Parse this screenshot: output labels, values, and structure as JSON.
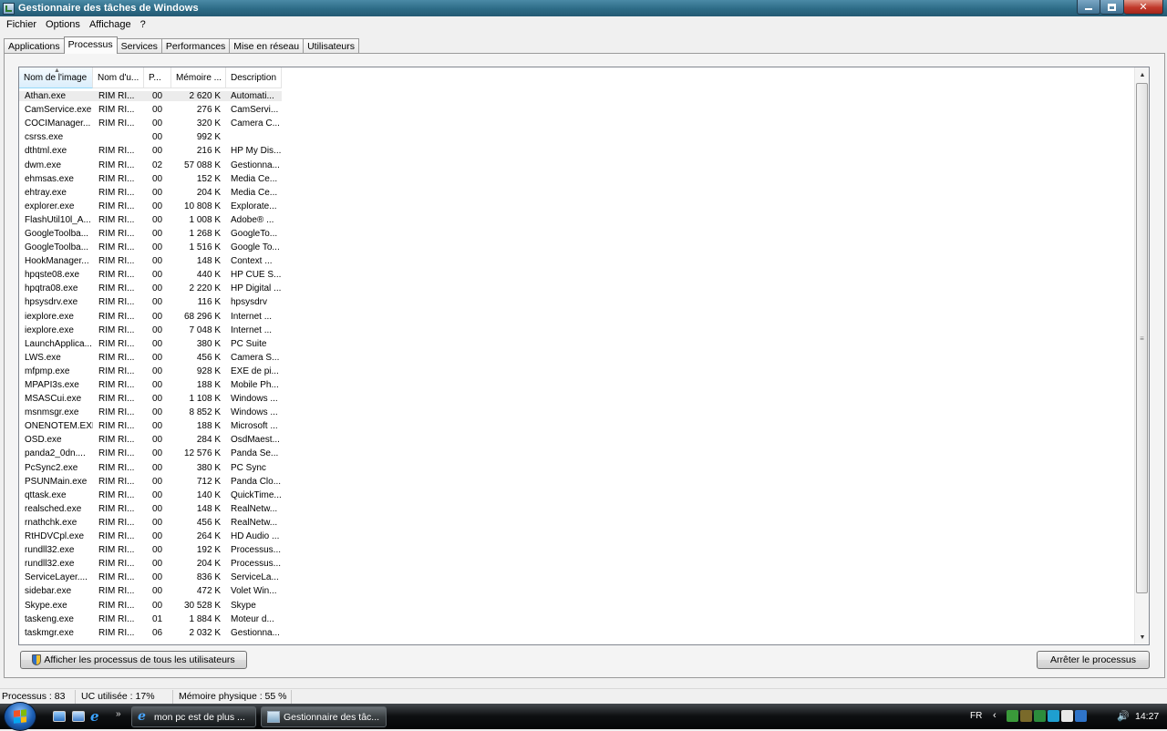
{
  "window": {
    "title": "Gestionnaire des tâches de Windows"
  },
  "menu": [
    "Fichier",
    "Options",
    "Affichage",
    "?"
  ],
  "tabs": [
    "Applications",
    "Processus",
    "Services",
    "Performances",
    "Mise en réseau",
    "Utilisateurs"
  ],
  "active_tab": "Processus",
  "columns": [
    "Nom de l'image",
    "Nom d'u...",
    "P...",
    "Mémoire ...",
    "Description"
  ],
  "rows": [
    {
      "name": "Athan.exe",
      "user": "RIM RI...",
      "cpu": "00",
      "mem": "2 620 K",
      "desc": "Automati..."
    },
    {
      "name": "CamService.exe",
      "user": "RIM RI...",
      "cpu": "00",
      "mem": "276 K",
      "desc": "CamServi..."
    },
    {
      "name": "COCIManager...",
      "user": "RIM RI...",
      "cpu": "00",
      "mem": "320 K",
      "desc": "Camera C..."
    },
    {
      "name": "csrss.exe",
      "user": "",
      "cpu": "00",
      "mem": "992 K",
      "desc": ""
    },
    {
      "name": "dthtml.exe",
      "user": "RIM RI...",
      "cpu": "00",
      "mem": "216 K",
      "desc": "HP My Dis..."
    },
    {
      "name": "dwm.exe",
      "user": "RIM RI...",
      "cpu": "02",
      "mem": "57 088 K",
      "desc": "Gestionna..."
    },
    {
      "name": "ehmsas.exe",
      "user": "RIM RI...",
      "cpu": "00",
      "mem": "152 K",
      "desc": "Media Ce..."
    },
    {
      "name": "ehtray.exe",
      "user": "RIM RI...",
      "cpu": "00",
      "mem": "204 K",
      "desc": "Media Ce..."
    },
    {
      "name": "explorer.exe",
      "user": "RIM RI...",
      "cpu": "00",
      "mem": "10 808 K",
      "desc": "Explorate..."
    },
    {
      "name": "FlashUtil10l_A...",
      "user": "RIM RI...",
      "cpu": "00",
      "mem": "1 008 K",
      "desc": "Adobe® ..."
    },
    {
      "name": "GoogleToolba...",
      "user": "RIM RI...",
      "cpu": "00",
      "mem": "1 268 K",
      "desc": "GoogleTo..."
    },
    {
      "name": "GoogleToolba...",
      "user": "RIM RI...",
      "cpu": "00",
      "mem": "1 516 K",
      "desc": "Google To..."
    },
    {
      "name": "HookManager...",
      "user": "RIM RI...",
      "cpu": "00",
      "mem": "148 K",
      "desc": "Context ..."
    },
    {
      "name": "hpqste08.exe",
      "user": "RIM RI...",
      "cpu": "00",
      "mem": "440 K",
      "desc": "HP CUE S..."
    },
    {
      "name": "hpqtra08.exe",
      "user": "RIM RI...",
      "cpu": "00",
      "mem": "2 220 K",
      "desc": "HP Digital ..."
    },
    {
      "name": "hpsysdrv.exe",
      "user": "RIM RI...",
      "cpu": "00",
      "mem": "116 K",
      "desc": "hpsysdrv"
    },
    {
      "name": "iexplore.exe",
      "user": "RIM RI...",
      "cpu": "00",
      "mem": "68 296 K",
      "desc": "Internet ..."
    },
    {
      "name": "iexplore.exe",
      "user": "RIM RI...",
      "cpu": "00",
      "mem": "7 048 K",
      "desc": "Internet ..."
    },
    {
      "name": "LaunchApplica...",
      "user": "RIM RI...",
      "cpu": "00",
      "mem": "380 K",
      "desc": "PC Suite"
    },
    {
      "name": "LWS.exe",
      "user": "RIM RI...",
      "cpu": "00",
      "mem": "456 K",
      "desc": "Camera S..."
    },
    {
      "name": "mfpmp.exe",
      "user": "RIM RI...",
      "cpu": "00",
      "mem": "928 K",
      "desc": "EXE de pi..."
    },
    {
      "name": "MPAPI3s.exe",
      "user": "RIM RI...",
      "cpu": "00",
      "mem": "188 K",
      "desc": "Mobile Ph..."
    },
    {
      "name": "MSASCui.exe",
      "user": "RIM RI...",
      "cpu": "00",
      "mem": "1 108 K",
      "desc": "Windows ..."
    },
    {
      "name": "msnmsgr.exe",
      "user": "RIM RI...",
      "cpu": "00",
      "mem": "8 852 K",
      "desc": "Windows ..."
    },
    {
      "name": "ONENOTEM.EXE",
      "user": "RIM RI...",
      "cpu": "00",
      "mem": "188 K",
      "desc": "Microsoft ..."
    },
    {
      "name": "OSD.exe",
      "user": "RIM RI...",
      "cpu": "00",
      "mem": "284 K",
      "desc": "OsdMaest..."
    },
    {
      "name": "panda2_0dn....",
      "user": "RIM RI...",
      "cpu": "00",
      "mem": "12 576 K",
      "desc": "Panda Se..."
    },
    {
      "name": "PcSync2.exe",
      "user": "RIM RI...",
      "cpu": "00",
      "mem": "380 K",
      "desc": "PC Sync"
    },
    {
      "name": "PSUNMain.exe",
      "user": "RIM RI...",
      "cpu": "00",
      "mem": "712 K",
      "desc": "Panda Clo..."
    },
    {
      "name": "qttask.exe",
      "user": "RIM RI...",
      "cpu": "00",
      "mem": "140 K",
      "desc": "QuickTime..."
    },
    {
      "name": "realsched.exe",
      "user": "RIM RI...",
      "cpu": "00",
      "mem": "148 K",
      "desc": "RealNetw..."
    },
    {
      "name": "rnathchk.exe",
      "user": "RIM RI...",
      "cpu": "00",
      "mem": "456 K",
      "desc": "RealNetw..."
    },
    {
      "name": "RtHDVCpl.exe",
      "user": "RIM RI...",
      "cpu": "00",
      "mem": "264 K",
      "desc": "HD Audio ..."
    },
    {
      "name": "rundll32.exe",
      "user": "RIM RI...",
      "cpu": "00",
      "mem": "192 K",
      "desc": "Processus..."
    },
    {
      "name": "rundll32.exe",
      "user": "RIM RI...",
      "cpu": "00",
      "mem": "204 K",
      "desc": "Processus..."
    },
    {
      "name": "ServiceLayer....",
      "user": "RIM RI...",
      "cpu": "00",
      "mem": "836 K",
      "desc": "ServiceLa..."
    },
    {
      "name": "sidebar.exe",
      "user": "RIM RI...",
      "cpu": "00",
      "mem": "472 K",
      "desc": "Volet Win..."
    },
    {
      "name": "Skype.exe",
      "user": "RIM RI...",
      "cpu": "00",
      "mem": "30 528 K",
      "desc": "Skype"
    },
    {
      "name": "taskeng.exe",
      "user": "RIM RI...",
      "cpu": "01",
      "mem": "1 884 K",
      "desc": "Moteur d..."
    },
    {
      "name": "taskmgr.exe",
      "user": "RIM RI...",
      "cpu": "06",
      "mem": "2 032 K",
      "desc": "Gestionna..."
    }
  ],
  "selected_row": 0,
  "buttons": {
    "show_all": "Afficher les processus de tous les utilisateurs",
    "end_process": "Arrêter le processus"
  },
  "status": {
    "processes": "Processus : 83",
    "cpu": "UC utilisée : 17%",
    "memory": "Mémoire physique : 55 %"
  },
  "taskbar": {
    "items": [
      "mon pc est de plus ...",
      "Gestionnaire des tâc..."
    ],
    "language": "FR",
    "clock": "14:27"
  },
  "colors": {
    "title_bar": "#2d6b86",
    "taskbar": "#0e1012",
    "sorted_column": "#dbeefb"
  }
}
